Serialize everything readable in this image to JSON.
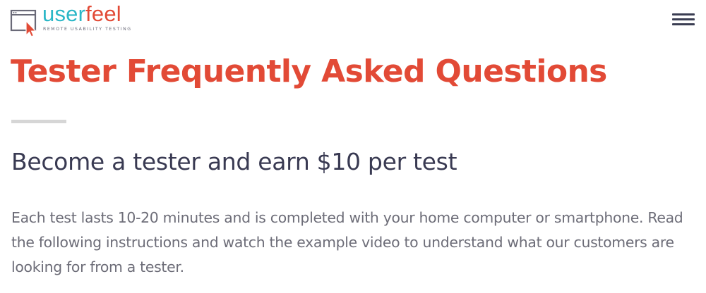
{
  "header": {
    "logo": {
      "word_part1": "user",
      "word_part2": "feel",
      "tagline": "REMOTE USABILITY TESTING",
      "icon": "browser-window-cursor-icon",
      "colors": {
        "teal": "#2bb7c7",
        "red": "#e24a36"
      }
    },
    "menu": {
      "icon": "hamburger-menu-icon"
    }
  },
  "main": {
    "title": "Tester Frequently Asked Questions",
    "subtitle": "Become a tester and earn $10 per test",
    "intro": "Each test lasts 10-20 minutes and is completed with your home computer or smartphone. Read the following instructions and watch the example video to understand what our customers are looking for from a tester."
  },
  "colors": {
    "accent": "#e24a36",
    "heading": "#393a52",
    "body_text": "#6d6d78",
    "divider": "#d6d6d6"
  }
}
